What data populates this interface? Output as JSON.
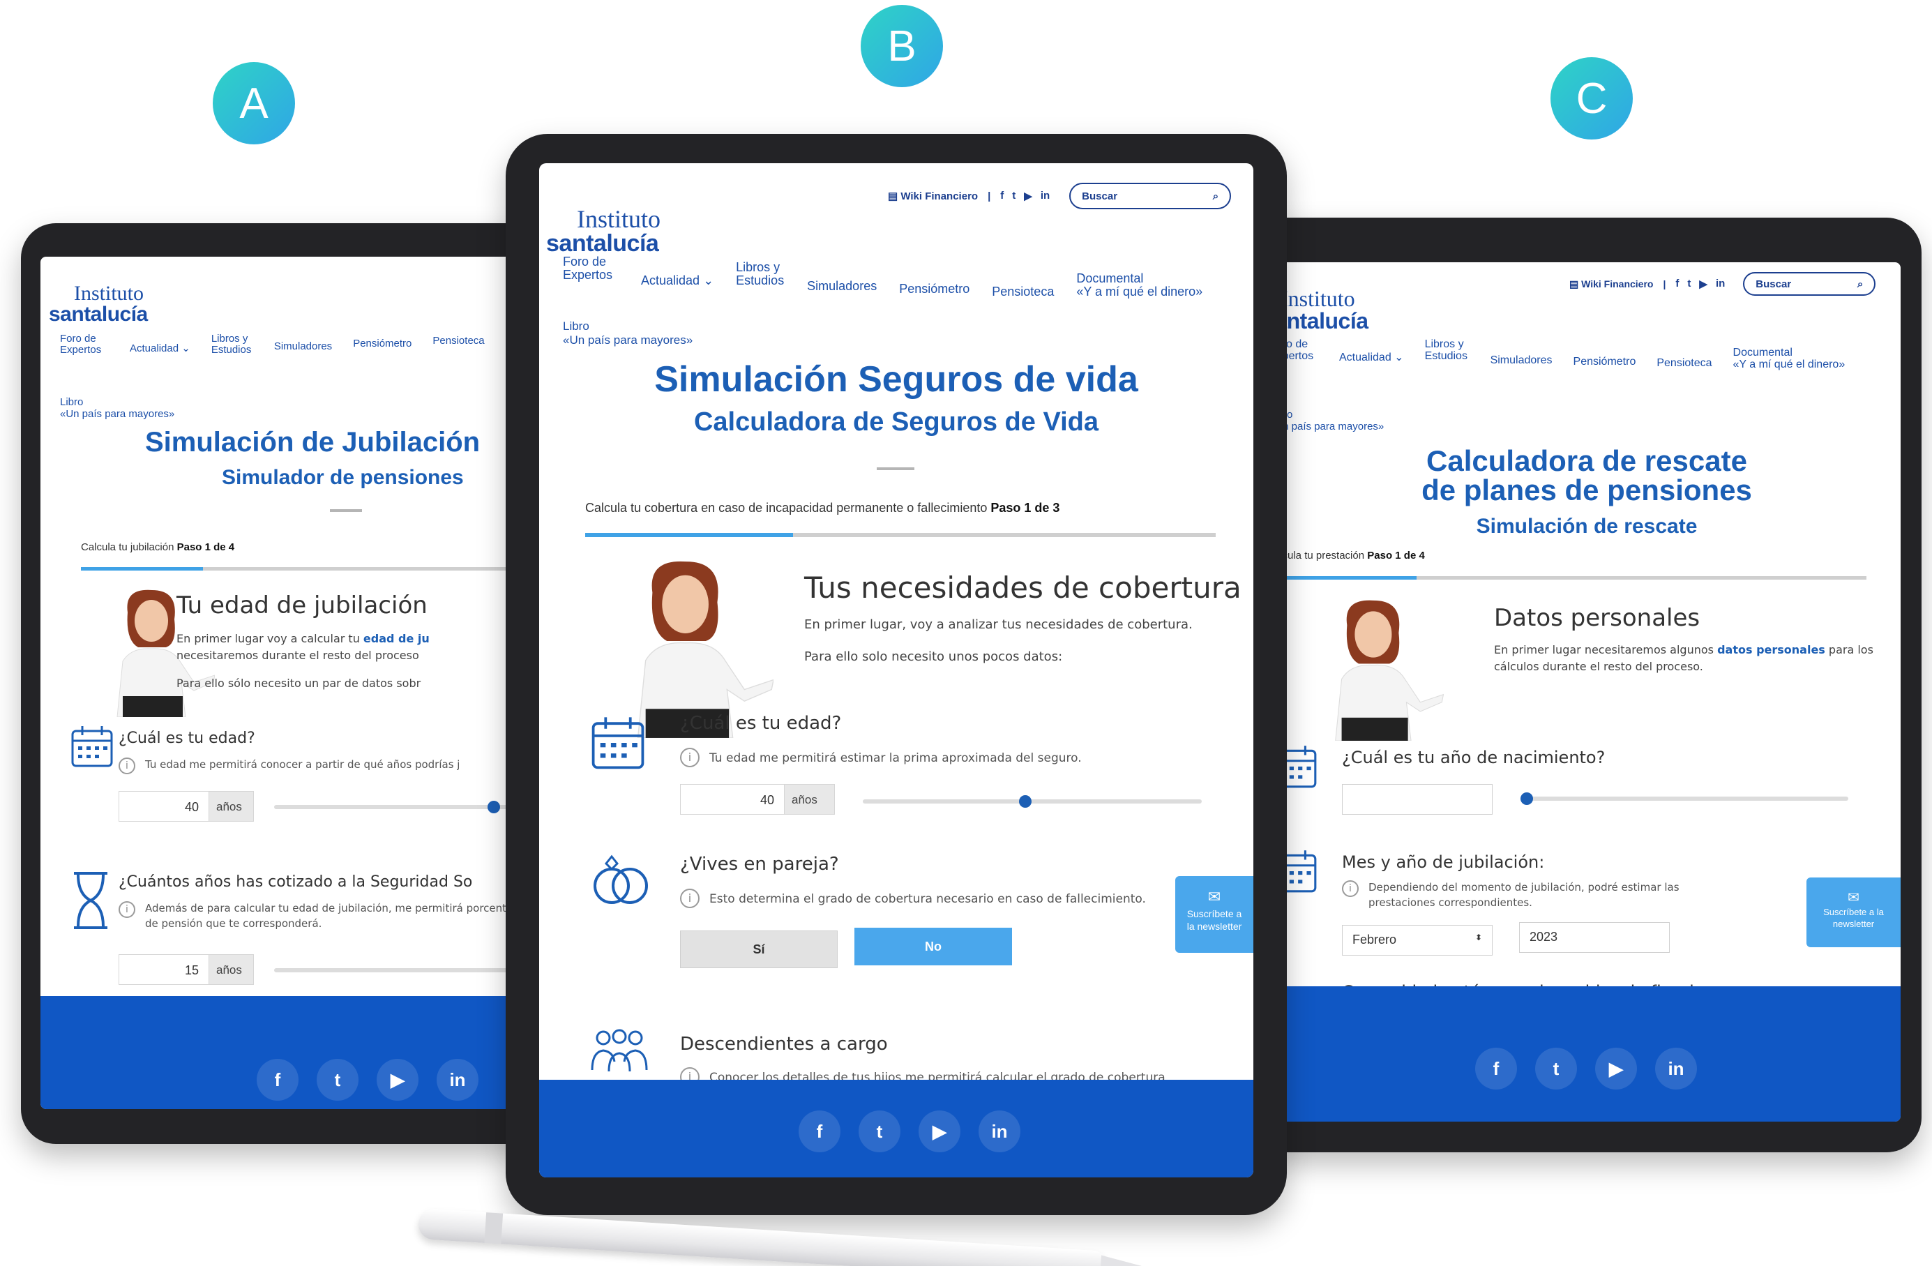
{
  "badges": [
    "A",
    "B",
    "C"
  ],
  "common": {
    "wiki": "Wiki Financiero",
    "search_label": "Buscar",
    "logo_line1": "Instituto",
    "logo_line2": "santalucía",
    "nav": {
      "foro": "Foro de Expertos",
      "actualidad": "Actualidad",
      "libros": "Libros y Estudios",
      "simuladores": "Simuladores",
      "pensiometro": "Pensiómetro",
      "pensioteca": "Pensioteca",
      "documental_1": "Documental",
      "documental_2": "«Y a mí qué el dinero»",
      "libro_1": "Libro",
      "libro_2": "«Un país para mayores»"
    },
    "newsletter": "Suscríbete a la newsletter",
    "units_years": "años",
    "colors": {
      "brand": "#1c5fb5",
      "footer": "#1057c4",
      "accent": "#3fa2e6"
    }
  },
  "tablet_a": {
    "title": "Simulación de Jubilación",
    "subtitle": "Simulador de pensiones",
    "step_text": "Calcula tu jubilación",
    "step_bold": "Paso 1 de 4",
    "progress": 0.25,
    "section_title": "Tu edad de jubilación",
    "para1_pre": "En primer lugar voy a calcular tu ",
    "para1_link": "edad de ju",
    "para1_post": "necesitaremos durante el resto del proceso",
    "para2": "Para ello sólo necesito un par de datos sobr",
    "q1_title": "¿Cuál es tu edad?",
    "q1_info": "Tu edad me permitirá conocer a partir de qué años podrías j",
    "q1_value": "40",
    "q1_slider": 0.75,
    "q2_title": "¿Cuántos años has cotizado a la Seguridad So",
    "q2_info": "Además de para calcular tu edad de jubilación, me permitirá porcentaje de pensión que te corresponderá.",
    "q2_value": "15",
    "q2_slider": 0.98
  },
  "tablet_b": {
    "title": "Simulación Seguros de vida",
    "subtitle": "Calculadora de Seguros de Vida",
    "step_text": "Calcula tu cobertura en caso de incapacidad permanente o fallecimiento",
    "step_bold": "Paso 1 de 3",
    "progress": 0.33,
    "section_title": "Tus necesidades de cobertura",
    "para1": "En primer lugar, voy a analizar tus necesidades de cobertura.",
    "para2": "Para ello solo necesito unos pocos datos:",
    "q1_title": "¿Cuál es tu edad?",
    "q1_info": "Tu edad me permitirá estimar la prima aproximada del seguro.",
    "q1_value": "40",
    "q1_slider": 0.48,
    "q2_title": "¿Vives en pareja?",
    "q2_info": "Esto determina el grado de cobertura necesario en caso de fallecimiento.",
    "btn_si": "Sí",
    "btn_no": "No",
    "q3_title": "Descendientes a cargo",
    "q3_info": "Conocer los detalles de tus hijos me permitirá calcular el grado de cobertura"
  },
  "tablet_c": {
    "title_1": "Calculadora de rescate",
    "title_2": "de planes de pensiones",
    "subtitle": "Simulación de rescate",
    "step_text": "Calcula tu prestación",
    "step_bold": "Paso 1 de 4",
    "progress": 0.25,
    "section_title": "Datos personales",
    "para1_pre": "En primer lugar necesitaremos algunos ",
    "para1_link": "datos personales",
    "para1_post": " para los cálculos durante el resto del proceso.",
    "q1_title": "¿Cuál es tu año de nacimiento?",
    "q1_value": "",
    "q1_slider": 0.02,
    "q2_title": "Mes y año de jubilación:",
    "q2_info": "Dependiendo del momento de jubilación, podré estimar las prestaciones correspondientes.",
    "month_selected": "Febrero",
    "year_value": "2023",
    "q3_title": "Comunidad autónoma de residencia fiscal"
  }
}
